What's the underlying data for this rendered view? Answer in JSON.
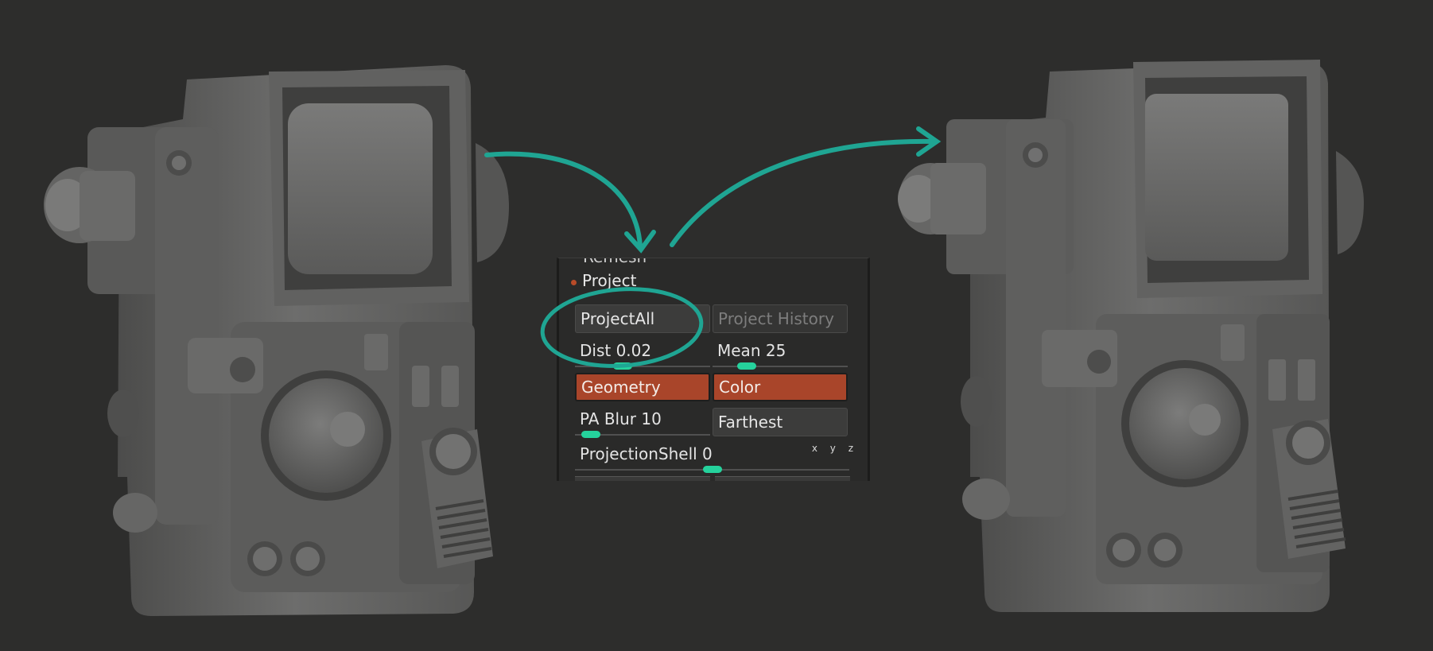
{
  "panel": {
    "cut_title": "Remesh",
    "section_title": "Project",
    "project_all_label": "ProjectAll",
    "project_history_label": "Project History",
    "dist": {
      "label": "Dist",
      "value": "0.02",
      "fraction": 0.35
    },
    "mean": {
      "label": "Mean",
      "value": "25",
      "fraction": 0.25
    },
    "geometry_label": "Geometry",
    "color_label": "Color",
    "pa_blur": {
      "label": "PA Blur",
      "value": "10",
      "fraction": 0.12
    },
    "farthest_label": "Farthest",
    "projection_shell": {
      "label": "ProjectionShell",
      "value": "0",
      "fraction": 0.5
    },
    "axis_label": "x y z"
  },
  "colors": {
    "background": "#2d2d2c",
    "accent_teal": "#1fa593",
    "active_orange": "#a9452a",
    "slider_green": "#25d29c"
  }
}
